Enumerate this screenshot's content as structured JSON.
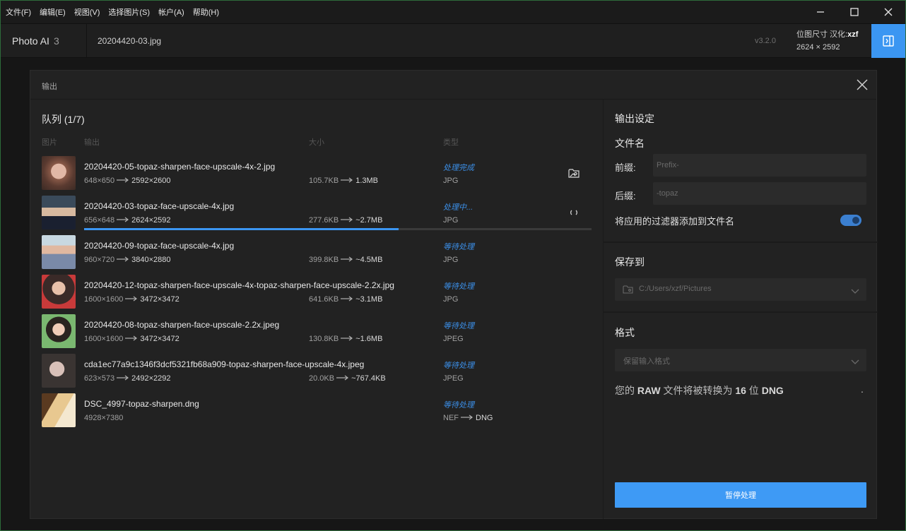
{
  "menubar": {
    "items": [
      "文件(F)",
      "编辑(E)",
      "视图(V)",
      "选择图片(S)",
      "帐户(A)",
      "帮助(H)"
    ]
  },
  "appbar": {
    "app_name": "Photo AI",
    "app_major": "3",
    "file_name": "20204420-03.jpg",
    "version": "v3.2.0",
    "size_label": "位图尺寸 汉化:",
    "translator": "xzf",
    "size_value": "2624 × 2592"
  },
  "dialog": {
    "title": "输出",
    "queue": {
      "title": "队列 (1/7)",
      "columns": [
        "图片",
        "输出",
        "大小",
        "类型"
      ],
      "rows": [
        {
          "filename": "20204420-05-topaz-sharpen-face-upscale-4x-2.jpg",
          "dims_from": "648×650",
          "dims_to": "2592×2600",
          "size_from": "105.7KB",
          "size_to": "1.3MB",
          "status": "处理完成",
          "type_from": "JPG",
          "type_to": "",
          "action_icon": "open-folder-image-icon"
        },
        {
          "filename": "20204420-03-topaz-face-upscale-4x.jpg",
          "dims_from": "656×648",
          "dims_to": "2624×2592",
          "size_from": "277.6KB",
          "size_to": "~2.7MB",
          "status": "处理中...",
          "type_from": "JPG",
          "type_to": "",
          "action_icon": "spinner-icon",
          "progress": 0.62
        },
        {
          "filename": "20204420-09-topaz-face-upscale-4x.jpg",
          "dims_from": "960×720",
          "dims_to": "3840×2880",
          "size_from": "399.8KB",
          "size_to": "~4.5MB",
          "status": "等待处理",
          "type_from": "JPG",
          "type_to": ""
        },
        {
          "filename": "20204420-12-topaz-sharpen-face-upscale-4x-topaz-sharpen-face-upscale-2.2x.jpg",
          "dims_from": "1600×1600",
          "dims_to": "3472×3472",
          "size_from": "641.6KB",
          "size_to": "~3.1MB",
          "status": "等待处理",
          "type_from": "JPG",
          "type_to": ""
        },
        {
          "filename": "20204420-08-topaz-sharpen-face-upscale-2.2x.jpeg",
          "dims_from": "1600×1600",
          "dims_to": "3472×3472",
          "size_from": "130.8KB",
          "size_to": "~1.6MB",
          "status": "等待处理",
          "type_from": "JPEG",
          "type_to": ""
        },
        {
          "filename": "cda1ec77a9c1346f3dcf5321fb68a909-topaz-sharpen-face-upscale-4x.jpeg",
          "dims_from": "623×573",
          "dims_to": "2492×2292",
          "size_from": "20.0KB",
          "size_to": "~767.4KB",
          "status": "等待处理",
          "type_from": "JPEG",
          "type_to": ""
        },
        {
          "filename": "DSC_4997-topaz-sharpen.dng",
          "dims_from": "4928×7380",
          "dims_to": "",
          "size_from": "",
          "size_to": "",
          "status": "等待处理",
          "type_from": "NEF",
          "type_to": "DNG"
        }
      ]
    },
    "settings": {
      "title": "输出设定",
      "filename_section": "文件名",
      "prefix_label": "前缀:",
      "prefix_placeholder": "Prefix-",
      "suffix_label": "后缀:",
      "suffix_placeholder": "-topaz",
      "filter_toggle_label": "将应用的过滤器添加到文件名",
      "filter_toggle_on": true,
      "save_section": "保存到",
      "save_path": "C:/Users/xzf/Pictures",
      "format_section": "格式",
      "format_value": "保留输入格式",
      "raw_note_prefix": "您的 ",
      "raw_note_raw": "RAW",
      "raw_note_mid": " 文件将被转换为 ",
      "raw_note_bits": "16",
      "raw_note_mid2": " 位 ",
      "raw_note_dng": "DNG",
      "raw_note_dot": ".",
      "pause_button": "暂停处理"
    }
  },
  "colors": {
    "accent": "#3b96f2",
    "status_blue": "#3b8fe8",
    "background": "#161616",
    "panel": "#222222"
  }
}
